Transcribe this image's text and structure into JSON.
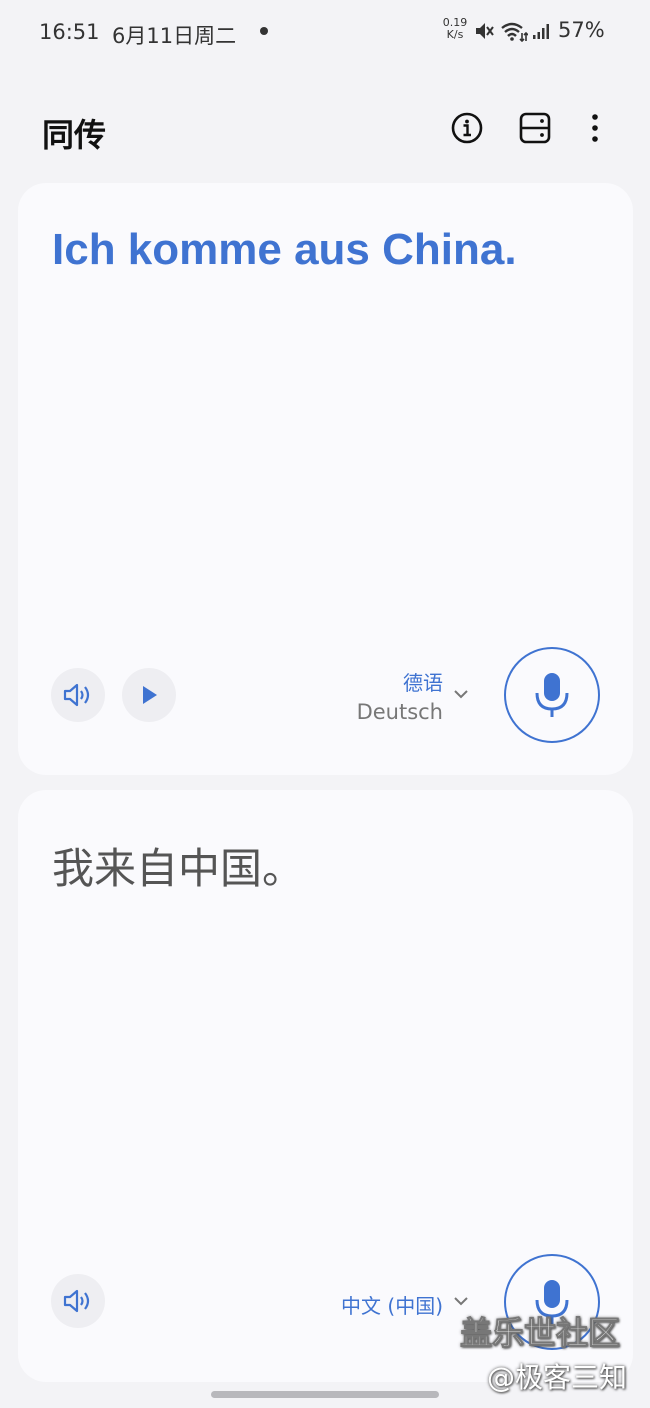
{
  "status_bar": {
    "time": "16:51",
    "date": "6月11日周二",
    "speed_value": "0.19",
    "speed_unit": "K/s",
    "battery": "57%"
  },
  "header": {
    "title": "同传"
  },
  "source_panel": {
    "text": "Ich komme aus China.",
    "language_name": "德语",
    "language_native": "Deutsch"
  },
  "target_panel": {
    "text": "我来自中国。",
    "language_name": "中文 (中国)"
  },
  "watermark": {
    "line1": "盖乐世社区",
    "line2": "@极客三知"
  },
  "colors": {
    "accent": "#3f73d1",
    "background": "#f3f3f6",
    "card": "#fafafd"
  },
  "icons": [
    "info-icon",
    "split-view-icon",
    "more-vert-icon",
    "speaker-icon",
    "play-icon",
    "chevron-down-icon",
    "microphone-icon"
  ]
}
